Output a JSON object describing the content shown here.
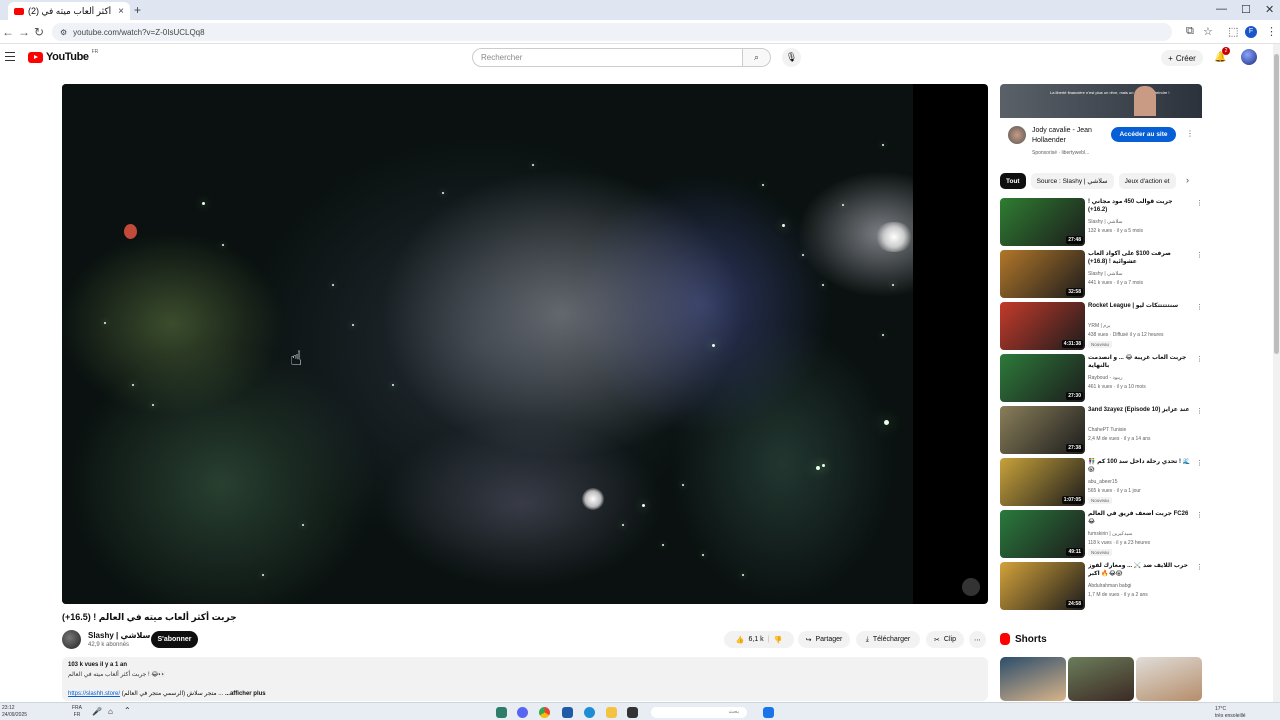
{
  "browser": {
    "tab_title": "(2) جربت أكثر ألعاب ميته في ...",
    "tab_close": "×",
    "new_tab": "+",
    "url": "youtube.com/watch?v=Z-0IsUCLQq8"
  },
  "header": {
    "logo_text": "YouTube",
    "country": "FR",
    "search_placeholder": "Rechercher",
    "create_label": "Créer",
    "notif_count": "2"
  },
  "video": {
    "title": "جربت أكثر ألعاب ميته في العالم ! (16.5+)",
    "channel_name": "Slashy | سلاشي",
    "subscribers": "42,9 k abonnés",
    "subscribe_label": "S'abonner",
    "likes": "6,1 k",
    "share_label": "Partager",
    "download_label": "Télécharger",
    "clip_label": "Clip",
    "desc_stats": "103 k vues  il y a 1 an",
    "desc_line": "جربت أكثر ألعاب ميته في العالم ! 😂👀",
    "desc_link": "https://slashh.store/",
    "desc_link_tail": "(متجر سلاش (الرسمي متجر في العالم ...",
    "show_more": "...afficher plus"
  },
  "ad": {
    "title": "Jody cavalie - Jean Hollaender",
    "sponsored": "Sponsorisé · libertywebl...",
    "cta": "Accéder au site",
    "banner_text": "La liberté financière n'est plus un rêve, mais un objectif à atteindre !"
  },
  "chips": [
    "Tout",
    "Source : Slashy | سلاشي",
    "Jeux d'action et"
  ],
  "recommendations": [
    {
      "title": "جربت قوالب 450 مود مجاني ! (16.2+)",
      "channel": "Slashy | سلاشي",
      "meta": "132 k vues · il y a 5 mois",
      "duration": "27:48",
      "badge": "",
      "color": "#2f7d32"
    },
    {
      "title": "صرفت 100$ على أكواد ألعاب عشوائية ! (16.8+)",
      "channel": "Slashy | سلاشي",
      "meta": "441 k vues · il y a 7 mois",
      "duration": "32:58",
      "badge": "",
      "color": "#b2772a"
    },
    {
      "title": "Rocket League | سنتتتتتكات ليو",
      "channel": "YRM | يرم",
      "meta": "438 vues · Diffusé il y a 12 heures",
      "duration": "4:31:38",
      "badge": "Nouveau",
      "color": "#c43a2b"
    },
    {
      "title": "جربت ألعاب غريبة 😂 ... و انصدمت بالنهاية",
      "channel": "Rayboud - ريبود",
      "meta": "461 k vues · il y a 10 mois",
      "duration": "27:30",
      "badge": "",
      "color": "#2d7a3a"
    },
    {
      "title": "3and 3zayez (Episode 10) عند عزايز",
      "channel": "ChahePT Tunisie",
      "meta": "2,4 M de vues · il y a 14 ans",
      "duration": "27:38",
      "badge": "",
      "color": "#8a7f5a"
    },
    {
      "title": "👫 تحدي رحلة داخل سد 100 كم ! 🌊😱",
      "channel": "abu_abeer15",
      "meta": "565 k vues · il y a 1 jour",
      "duration": "1:07:05",
      "badge": "Nouveau",
      "color": "#c8a23a"
    },
    {
      "title": "جربت أضعف فريق في العالم FC26 😂",
      "channel": "fumskirin | سيدكيرين",
      "meta": "118 k vues · il y a 23 heures",
      "duration": "49:11",
      "badge": "Nouveau",
      "color": "#2a7a3d"
    },
    {
      "title": "حرب اللايف ضد ⚔️ ... ومعارك لفوز اكبر 🔥😂😱",
      "channel": "Abdulrahman babgi",
      "meta": "1,7 M de vues · il y a 2 ans",
      "duration": "24:58",
      "badge": "",
      "color": "#d4a23a"
    }
  ],
  "shorts_label": "Shorts",
  "taskbar": {
    "time": "23:12",
    "date": "24/09/2025",
    "lang1": "FRA",
    "lang2": "FR",
    "search_placeholder": "بحث",
    "weather_temp": "17°C",
    "weather_desc": "très ensoleillé"
  },
  "colors": {
    "brand": "#ff0000",
    "accent": "#065fd4"
  }
}
